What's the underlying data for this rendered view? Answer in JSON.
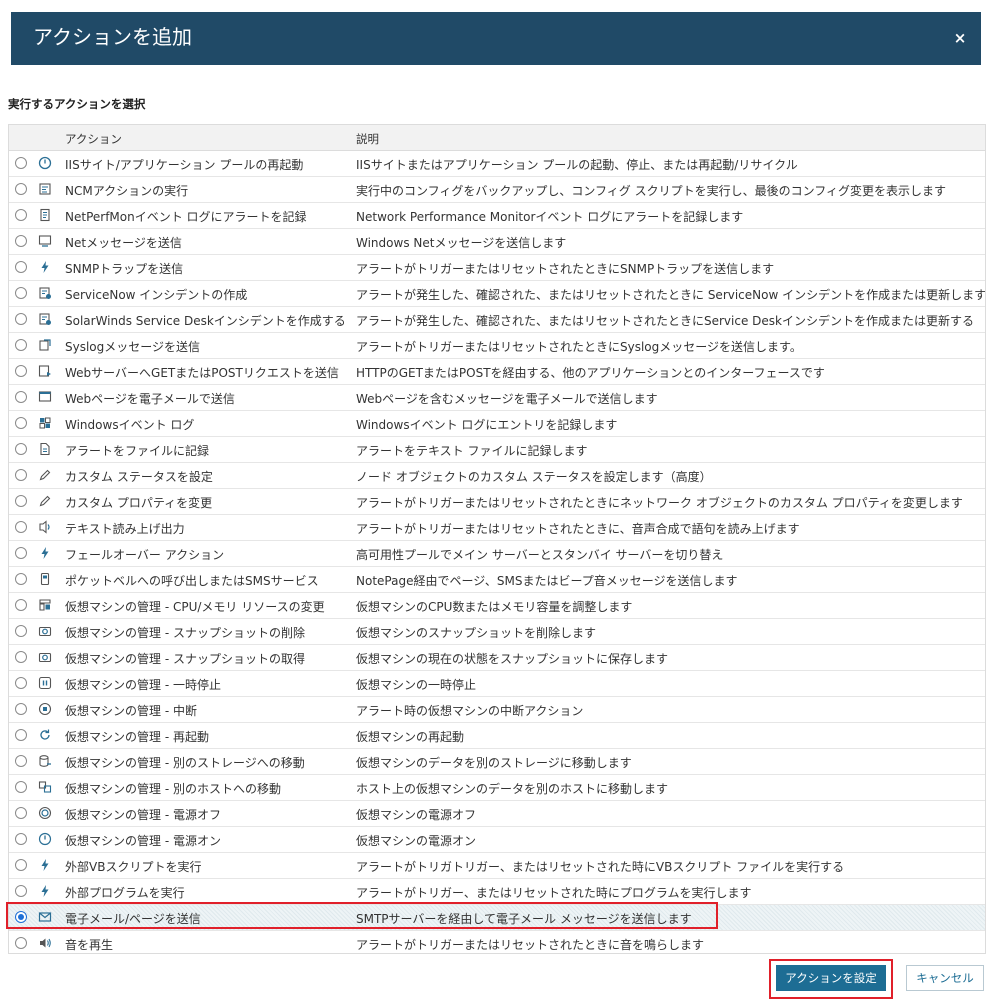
{
  "dialog": {
    "title": "アクションを追加",
    "close_label": "×"
  },
  "section_label": "実行するアクションを選択",
  "grid": {
    "columns": [
      "アクション",
      "説明"
    ],
    "selected_index": 29,
    "rows": [
      {
        "icon": "restart-icon",
        "action": "IISサイト/アプリケーション プールの再起動",
        "description": "IISサイトまたはアプリケーション プールの起動、停止、または再起動/リサイクル"
      },
      {
        "icon": "ncm-icon",
        "action": "NCMアクションの実行",
        "description": "実行中のコンフィグをバックアップし、コンフィグ スクリプトを実行し、最後のコンフィグ変更を表示します"
      },
      {
        "icon": "log-icon",
        "action": "NetPerfMonイベント ログにアラートを記録",
        "description": "Network Performance Monitorイベント ログにアラートを記録します"
      },
      {
        "icon": "message-icon",
        "action": "Netメッセージを送信",
        "description": "Windows Netメッセージを送信します"
      },
      {
        "icon": "lightning-icon",
        "action": "SNMPトラップを送信",
        "description": "アラートがトリガーまたはリセットされたときにSNMPトラップを送信します"
      },
      {
        "icon": "ticket-icon",
        "action": "ServiceNow インシデントの作成",
        "description": "アラートが発生した、確認された、またはリセットされたときに ServiceNow インシデントを作成または更新します"
      },
      {
        "icon": "ticket-icon",
        "action": "SolarWinds Service Deskインシデントを作成する",
        "description": "アラートが発生した、確認された、またはリセットされたときにService Deskインシデントを作成または更新する"
      },
      {
        "icon": "syslog-icon",
        "action": "Syslogメッセージを送信",
        "description": "アラートがトリガーまたはリセットされたときにSyslogメッセージを送信します。"
      },
      {
        "icon": "web-request-icon",
        "action": "WebサーバーへGETまたはPOSTリクエストを送信",
        "description": "HTTPのGETまたはPOSTを経由する、他のアプリケーションとのインターフェースです"
      },
      {
        "icon": "webpage-icon",
        "action": "Webページを電子メールで送信",
        "description": "Webページを含むメッセージを電子メールで送信します"
      },
      {
        "icon": "windows-log-icon",
        "action": "Windowsイベント ログ",
        "description": "Windowsイベント ログにエントリを記録します"
      },
      {
        "icon": "file-icon",
        "action": "アラートをファイルに記録",
        "description": "アラートをテキスト ファイルに記録します"
      },
      {
        "icon": "pencil-icon",
        "action": "カスタム ステータスを設定",
        "description": "ノード オブジェクトのカスタム ステータスを設定します（高度）"
      },
      {
        "icon": "pencil-icon",
        "action": "カスタム プロパティを変更",
        "description": "アラートがトリガーまたはリセットされたときにネットワーク オブジェクトのカスタム プロパティを変更します"
      },
      {
        "icon": "speech-icon",
        "action": "テキスト読み上げ出力",
        "description": "アラートがトリガーまたはリセットされたときに、音声合成で語句を読み上げます"
      },
      {
        "icon": "lightning-icon",
        "action": "フェールオーバー アクション",
        "description": "高可用性プールでメイン サーバーとスタンバイ サーバーを切り替え"
      },
      {
        "icon": "pager-icon",
        "action": "ポケットベルへの呼び出しまたはSMSサービス",
        "description": "NotePage経由でページ、SMSまたはビープ音メッセージを送信します"
      },
      {
        "icon": "vm-resources-icon",
        "action": "仮想マシンの管理 - CPU/メモリ リソースの変更",
        "description": "仮想マシンのCPU数またはメモリ容量を調整します"
      },
      {
        "icon": "camera-icon",
        "action": "仮想マシンの管理 - スナップショットの削除",
        "description": "仮想マシンのスナップショットを削除します"
      },
      {
        "icon": "camera-icon",
        "action": "仮想マシンの管理 - スナップショットの取得",
        "description": "仮想マシンの現在の状態をスナップショットに保存します"
      },
      {
        "icon": "pause-icon",
        "action": "仮想マシンの管理 - 一時停止",
        "description": "仮想マシンの一時停止"
      },
      {
        "icon": "suspend-icon",
        "action": "仮想マシンの管理 - 中断",
        "description": "アラート時の仮想マシンの中断アクション"
      },
      {
        "icon": "reboot-icon",
        "action": "仮想マシンの管理 - 再起動",
        "description": "仮想マシンの再起動"
      },
      {
        "icon": "storage-icon",
        "action": "仮想マシンの管理 - 別のストレージへの移動",
        "description": "仮想マシンのデータを別のストレージに移動します"
      },
      {
        "icon": "host-move-icon",
        "action": "仮想マシンの管理 - 別のホストへの移動",
        "description": "ホスト上の仮想マシンのデータを別のホストに移動します"
      },
      {
        "icon": "power-off-icon",
        "action": "仮想マシンの管理 - 電源オフ",
        "description": "仮想マシンの電源オフ"
      },
      {
        "icon": "power-on-icon",
        "action": "仮想マシンの管理 - 電源オン",
        "description": "仮想マシンの電源オン"
      },
      {
        "icon": "lightning-icon",
        "action": "外部VBスクリプトを実行",
        "description": "アラートがトリガトリガー、またはリセットされた時にVBスクリプト ファイルを実行する"
      },
      {
        "icon": "lightning-icon",
        "action": "外部プログラムを実行",
        "description": "アラートがトリガー、またはリセットされた時にプログラムを実行します"
      },
      {
        "icon": "email-icon",
        "action": "電子メール/ページを送信",
        "description": "SMTPサーバーを経由して電子メール メッセージを送信します"
      },
      {
        "icon": "speaker-icon",
        "action": "音を再生",
        "description": "アラートがトリガーまたはリセットされたときに音を鳴らします"
      }
    ]
  },
  "buttons": {
    "configure_label": "アクションを設定",
    "cancel_label": "キャンセル"
  },
  "colors": {
    "title_bar": "#204a67",
    "primary_button": "#1d6d94",
    "highlight_border": "#e0202a",
    "radio_checked": "#1e6fd6"
  }
}
